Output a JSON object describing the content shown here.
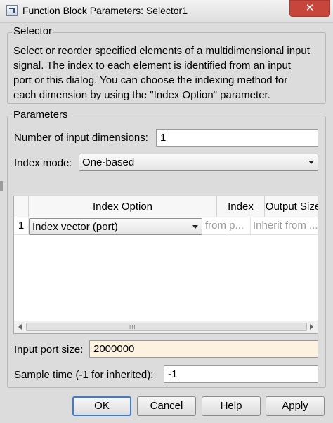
{
  "window": {
    "title": "Function Block Parameters: Selector1",
    "close_glyph": "✕"
  },
  "selector_group": {
    "label": "Selector",
    "description_lines": [
      "Select or reorder specified elements of a multidimensional input",
      "signal. The index to each element is identified from an input",
      "port or this dialog. You can choose the indexing method for",
      "each dimension by using the \"Index Option\" parameter."
    ]
  },
  "parameters": {
    "label": "Parameters",
    "num_dims_label": "Number of input dimensions:",
    "num_dims_value": "1",
    "index_mode_label": "Index mode:",
    "index_mode_value": "One-based",
    "table": {
      "headers": [
        "Index Option",
        "Index",
        "Output Size"
      ],
      "rows": [
        {
          "num": "1",
          "option": "Index vector (port)",
          "index": "from p...",
          "output_size": "Inherit from ..."
        }
      ],
      "scroll_grip": "III"
    },
    "input_port_size_label": "Input port size:",
    "input_port_size_value": "2000000",
    "sample_time_label": "Sample time (-1 for inherited):",
    "sample_time_value": "-1"
  },
  "buttons": {
    "ok": "OK",
    "cancel": "Cancel",
    "help": "Help",
    "apply": "Apply"
  }
}
